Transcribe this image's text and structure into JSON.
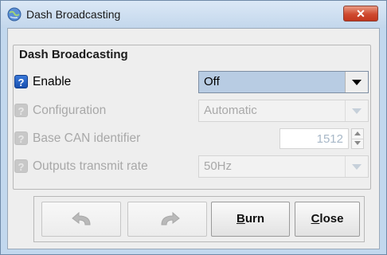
{
  "window": {
    "title": "Dash Broadcasting",
    "close_glyph": "✕",
    "icon": "app-globe-icon"
  },
  "group": {
    "title": "Dash Broadcasting"
  },
  "fields": {
    "enable": {
      "label": "Enable",
      "value": "Off",
      "help": "?"
    },
    "configuration": {
      "label": "Configuration",
      "value": "Automatic",
      "help": "?"
    },
    "base_can": {
      "label": "Base CAN identifier",
      "value": "1512",
      "help": "?"
    },
    "outputs_rate": {
      "label": "Outputs transmit rate",
      "value": "50Hz",
      "help": "?"
    }
  },
  "buttons": {
    "undo_icon": "undo-arrow-icon",
    "redo_icon": "redo-arrow-icon",
    "burn_mnemonic": "B",
    "burn_rest": "urn",
    "close_mnemonic": "C",
    "close_rest": "lose"
  },
  "colors": {
    "help_active": "#1f5fc4",
    "close_button": "#cf4a2f",
    "combo_selected": "#b8cce3"
  }
}
